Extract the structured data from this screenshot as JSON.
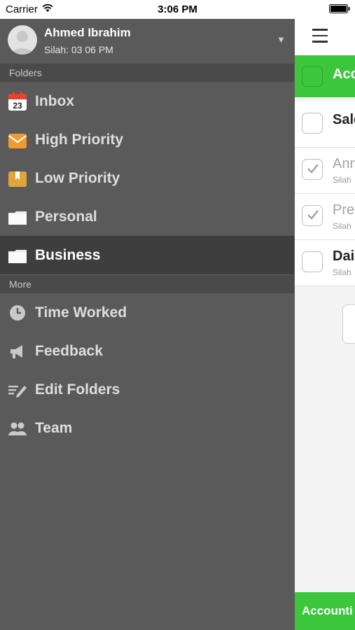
{
  "status_bar": {
    "carrier": "Carrier",
    "time": "3:06 PM"
  },
  "profile": {
    "name": "Ahmed Ibrahim",
    "subtitle": "Silah: 03 06 PM"
  },
  "sections": {
    "folders": "Folders",
    "more": "More"
  },
  "folders": [
    {
      "label": "Inbox",
      "icon": "calendar-icon",
      "calendar_day": "23"
    },
    {
      "label": "High Priority",
      "icon": "orange-envelope-icon"
    },
    {
      "label": "Low Priority",
      "icon": "bookmark-box-icon"
    },
    {
      "label": "Personal",
      "icon": "folder-icon"
    },
    {
      "label": "Business",
      "icon": "folder-icon",
      "active": true
    }
  ],
  "more": [
    {
      "label": "Time Worked",
      "icon": "clock-icon"
    },
    {
      "label": "Feedback",
      "icon": "megaphone-icon"
    },
    {
      "label": "Edit Folders",
      "icon": "edit-list-icon"
    },
    {
      "label": "Team",
      "icon": "team-icon"
    }
  ],
  "tasks": [
    {
      "title": "Acc",
      "checked": false,
      "highlighted": true
    },
    {
      "title": "Sale",
      "checked": false
    },
    {
      "title": "Ann",
      "subtitle": "Silah",
      "checked": true
    },
    {
      "title": "Pre",
      "subtitle": "Silah",
      "checked": true
    },
    {
      "title": "Dai",
      "subtitle": "Silah",
      "checked": false
    }
  ],
  "bottom_bar": {
    "label": "Accounti"
  },
  "colors": {
    "accent": "#3cc63c",
    "drawer_bg": "#5a5a5a",
    "section_bg": "#4a4a4a",
    "active_bg": "#3e3e3e"
  }
}
